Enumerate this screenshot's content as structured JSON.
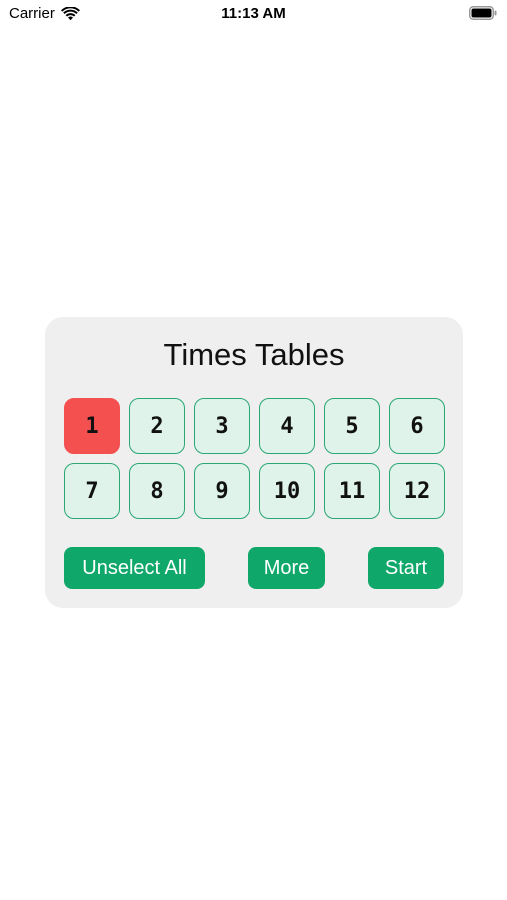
{
  "status_bar": {
    "carrier": "Carrier",
    "time": "11:13 AM",
    "wifi_icon": "wifi-icon",
    "battery_icon": "battery-icon"
  },
  "card": {
    "title": "Times Tables",
    "numbers": [
      {
        "label": "1",
        "selected": true
      },
      {
        "label": "2",
        "selected": false
      },
      {
        "label": "3",
        "selected": false
      },
      {
        "label": "4",
        "selected": false
      },
      {
        "label": "5",
        "selected": false
      },
      {
        "label": "6",
        "selected": false
      },
      {
        "label": "7",
        "selected": false
      },
      {
        "label": "8",
        "selected": false
      },
      {
        "label": "9",
        "selected": false
      },
      {
        "label": "10",
        "selected": false
      },
      {
        "label": "11",
        "selected": false
      },
      {
        "label": "12",
        "selected": false
      }
    ],
    "actions": {
      "unselect_all": "Unselect All",
      "more": "More",
      "start": "Start"
    }
  },
  "colors": {
    "selected": "#f45050",
    "unselected_fill": "#dff3ea",
    "unselected_border": "#2aa774",
    "action_button": "#0fa86a",
    "card_background": "#efefef"
  }
}
